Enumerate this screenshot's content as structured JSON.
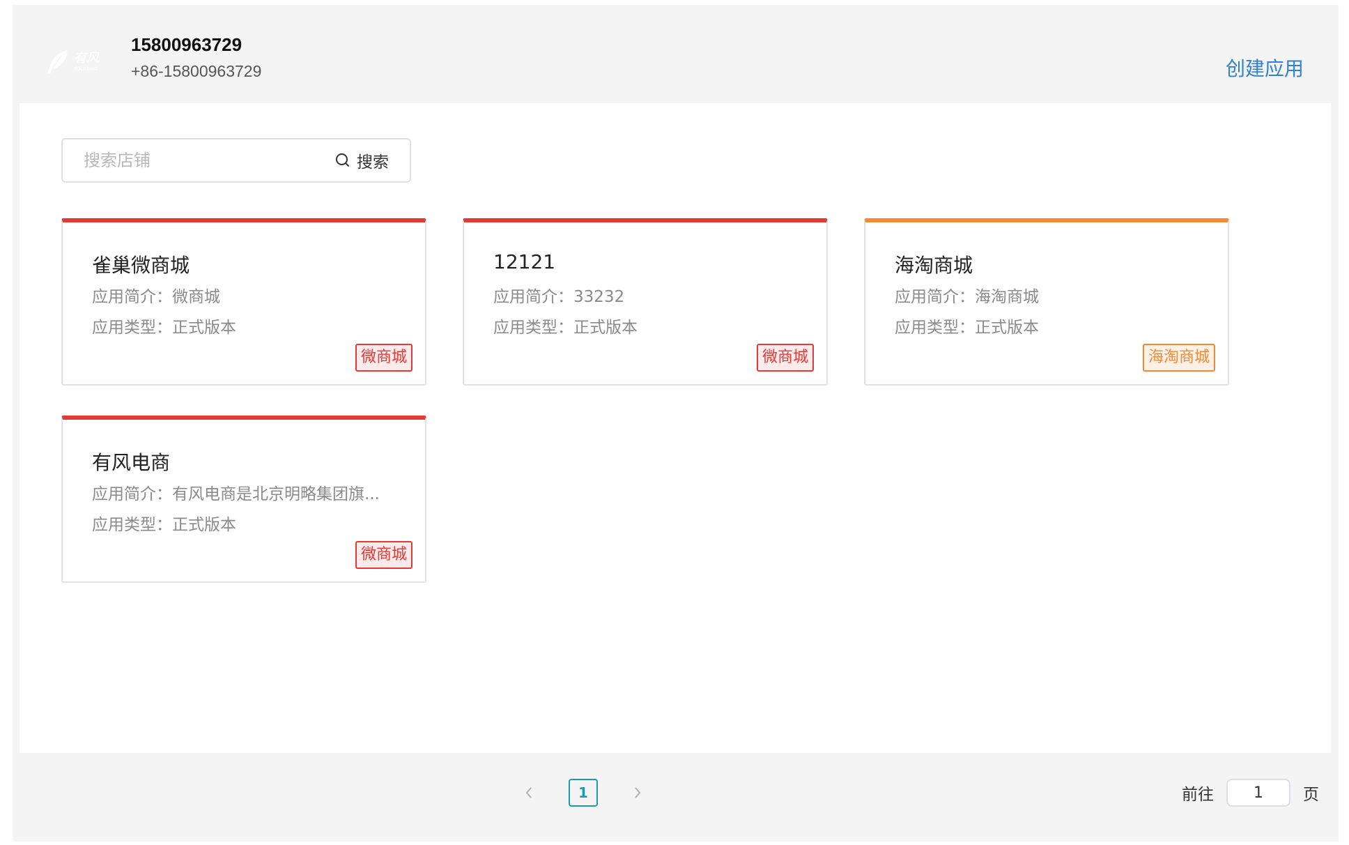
{
  "header": {
    "logo_text": "有风",
    "logo_subtext": "YOUFENG",
    "account_name": "15800963729",
    "account_phone": "+86-15800963729",
    "create_app_label": "创建应用"
  },
  "search": {
    "placeholder": "搜索店铺",
    "value": "",
    "button_label": "搜索"
  },
  "cards": [
    {
      "title": "雀巢微商城",
      "desc": "应用简介：微商城",
      "type": "应用类型：正式版本",
      "tag": "微商城",
      "accent": "#e53935"
    },
    {
      "title": "12121",
      "desc": "应用简介：33232",
      "type": "应用类型：正式版本",
      "tag": "微商城",
      "accent": "#e53935"
    },
    {
      "title": "海淘商城",
      "desc": "应用简介：海淘商城",
      "type": "应用类型：正式版本",
      "tag": "海淘商城",
      "accent": "#f08a37"
    },
    {
      "title": "有风电商",
      "desc": "应用简介：有风电商是北京明略集团旗...",
      "type": "应用类型：正式版本",
      "tag": "微商城",
      "accent": "#e53935"
    }
  ],
  "pagination": {
    "current_page": "1",
    "goto_prefix": "前往",
    "goto_value": "1",
    "goto_suffix": "页"
  },
  "colors": {
    "link": "#2f80d7",
    "micro_mall": "#e53935",
    "overseas_mall": "#f08a37",
    "page_active": "#1a9bb4"
  }
}
